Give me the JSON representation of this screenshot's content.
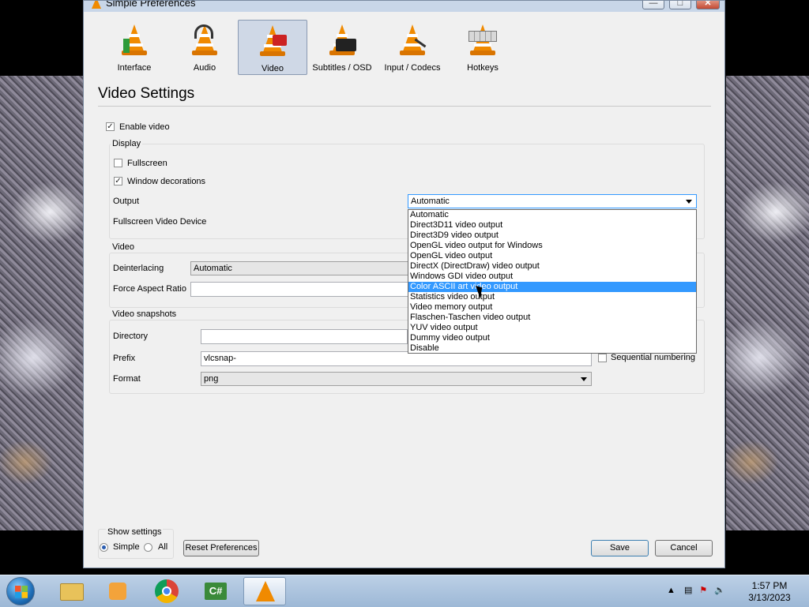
{
  "window": {
    "title": "Simple Preferences"
  },
  "tabs": [
    {
      "label": "Interface"
    },
    {
      "label": "Audio"
    },
    {
      "label": "Video"
    },
    {
      "label": "Subtitles / OSD"
    },
    {
      "label": "Input / Codecs"
    },
    {
      "label": "Hotkeys"
    }
  ],
  "heading": "Video Settings",
  "enable_video": {
    "label": "Enable video",
    "checked": true
  },
  "display": {
    "title": "Display",
    "fullscreen": {
      "label": "Fullscreen",
      "checked": false
    },
    "window_decorations": {
      "label": "Window decorations",
      "checked": true
    },
    "output_label": "Output",
    "output_value": "Automatic",
    "fullscreen_device_label": "Fullscreen Video Device"
  },
  "output_dropdown": {
    "selected_index": 7,
    "items": [
      "Automatic",
      "Direct3D11 video output",
      "Direct3D9 video output",
      "OpenGL video output for Windows",
      "OpenGL video output",
      "DirectX (DirectDraw) video output",
      "Windows GDI video output",
      "Color ASCII art video output",
      "Statistics video output",
      "Video memory output",
      "Flaschen-Taschen video output",
      "YUV video output",
      "Dummy video output",
      "Disable"
    ]
  },
  "video": {
    "title": "Video",
    "deinterlacing_label": "Deinterlacing",
    "deinterlacing_value": "Automatic",
    "aspect_label": "Force Aspect Ratio",
    "aspect_value": ""
  },
  "snapshots": {
    "title": "Video snapshots",
    "directory_label": "Directory",
    "directory_value": "",
    "prefix_label": "Prefix",
    "prefix_value": "vlcsnap-",
    "sequential_label": "Sequential numbering",
    "sequential_checked": false,
    "format_label": "Format",
    "format_value": "png"
  },
  "show_settings": {
    "title": "Show settings",
    "simple": "Simple",
    "all": "All",
    "selected": "Simple"
  },
  "buttons": {
    "reset": "Reset Preferences",
    "save": "Save",
    "cancel": "Cancel"
  },
  "clock": {
    "time": "1:57 PM",
    "date": "3/13/2023"
  },
  "colors": {
    "selection": "#3399ff",
    "vlc_orange": "#f08a00"
  }
}
